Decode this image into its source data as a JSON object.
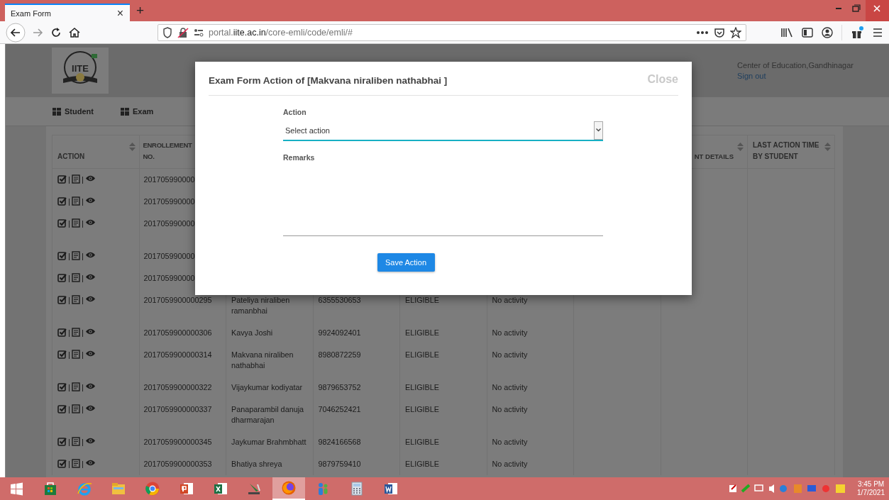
{
  "browser": {
    "tab_title": "Exam Form",
    "tab_close": "×",
    "new_tab": "+",
    "url": "portal.**iite.ac.in**/core-emli/code/emli/#"
  },
  "header": {
    "logo_text": "IITE",
    "institution": "Center of Education,Gandhinagar",
    "sign_out": "Sign out"
  },
  "nav": [
    {
      "label": "Student"
    },
    {
      "label": "Exam"
    }
  ],
  "table": {
    "columns_left": [
      {
        "label": "ACTION",
        "sortable": true
      },
      {
        "label": "ENROLLEMENT NO."
      }
    ],
    "columns_right": [
      {
        "label": "NT DETAILS",
        "sortable": true
      },
      {
        "label": "LAST ACTION TIME BY STUDENT",
        "sortable": true
      }
    ],
    "rows": [
      {
        "enrollment": "201705990000"
      },
      {
        "enrollment": "201705990000"
      },
      {
        "enrollment": "201705990000"
      },
      {
        "enrollment": "201705990000"
      },
      {
        "enrollment": "201705990000"
      },
      {
        "enrollment": "2017059900000295",
        "name": "Pateliya niraliben ramanbhai",
        "mobile": "6355530653",
        "status": "ELIGIBLE",
        "activity": "No activity"
      },
      {
        "enrollment": "2017059900000306",
        "name": "Kavya Joshi",
        "mobile": "9924092401",
        "status": "ELIGIBLE",
        "activity": "No activity"
      },
      {
        "enrollment": "2017059900000314",
        "name": "Makvana niraliben nathabhai",
        "mobile": "8980872259",
        "status": "ELIGIBLE",
        "activity": "No activity"
      },
      {
        "enrollment": "2017059900000322",
        "name": "Vijaykumar kodiyatar",
        "mobile": "9879653752",
        "status": "ELIGIBLE",
        "activity": "No activity"
      },
      {
        "enrollment": "2017059900000337",
        "name": "Panaparambil danuja dharmarajan",
        "mobile": "7046252421",
        "status": "ELIGIBLE",
        "activity": "No activity"
      },
      {
        "enrollment": "2017059900000345",
        "name": "Jaykumar Brahmbhatt",
        "mobile": "9824166568",
        "status": "ELIGIBLE",
        "activity": "No activity"
      },
      {
        "enrollment": "2017059900000353",
        "name": "Bhatiya shreya",
        "mobile": "9879759410",
        "status": "ELIGIBLE",
        "activity": "No activity"
      }
    ]
  },
  "modal": {
    "title": "Exam Form Action of [Makvana niraliben nathabhai ]",
    "close": "Close",
    "fields": [
      {
        "kind": "select",
        "label": "Action",
        "value": "Select action",
        "focused": true
      },
      {
        "kind": "textarea",
        "label": "Remarks",
        "focused": false
      }
    ],
    "button": "Save Action"
  },
  "taskbar": {
    "apps": [
      {
        "kind": "start",
        "selected": false
      },
      {
        "kind": "store",
        "selected": false
      },
      {
        "kind": "ie",
        "selected": false
      },
      {
        "kind": "explorer",
        "selected": false
      },
      {
        "kind": "chrome",
        "selected": false
      },
      {
        "kind": "powerpoint",
        "selected": false
      },
      {
        "kind": "excel",
        "selected": false
      },
      {
        "kind": "presenter",
        "selected": false
      },
      {
        "kind": "firefox",
        "selected": true
      },
      {
        "kind": "people",
        "selected": false
      },
      {
        "kind": "calculator",
        "selected": false
      },
      {
        "kind": "word",
        "selected": false
      }
    ],
    "time": "3:45 PM",
    "date": "1/7/2021"
  }
}
